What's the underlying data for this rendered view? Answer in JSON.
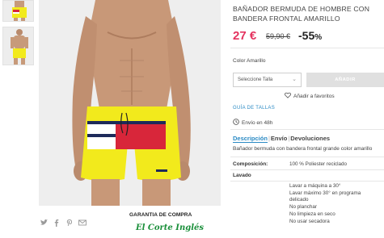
{
  "product": {
    "title": "BAÑADOR BERMUDA DE HOMBRE CON BANDERA FRONTAL AMARILLO",
    "price": "27 €",
    "old_price": "59,90 €",
    "discount": "-55",
    "discount_unit": "%"
  },
  "options": {
    "color_label": "Color Amarillo",
    "size_placeholder": "Seleccione Talla",
    "add_button": "AÑADIR",
    "favorites": "Añadir a favoritos",
    "size_guide": "GUÍA DE TALLAS",
    "delivery": "Envío en 48h"
  },
  "tabs": {
    "description": "Descripción",
    "shipping": "Envío",
    "returns": "Devoluciones"
  },
  "details": {
    "description": "Bañador bermuda con bandera frontal grande color amarillo",
    "composition_label": "Composición:",
    "composition_value": "100 % Poliester reciclado",
    "care_label": "Lavado",
    "care_items": [
      "Lavar a máquina a 30°",
      "Lavar máximo 30° en programa",
      "delicado",
      "No planchar",
      "No limpieza en seco",
      "No usar secadora"
    ]
  },
  "footer": {
    "guarantee": "GARANTIA DE COMPRA",
    "store_logo": "El Corte Inglés"
  },
  "colors": {
    "price": "#e4335f",
    "link": "#2a8ac4",
    "logo": "#1a8f3a",
    "shorts": "#f2ea1c"
  }
}
